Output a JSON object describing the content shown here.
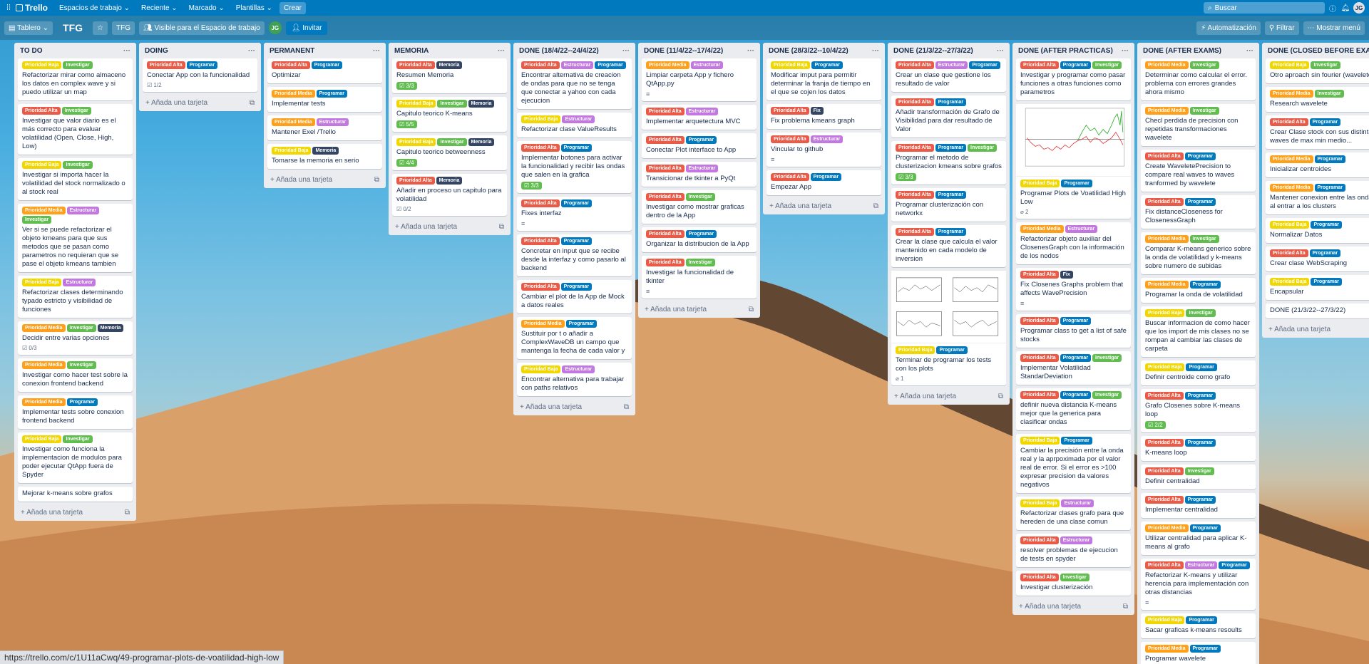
{
  "topbar": {
    "app": "Trello",
    "menus": [
      "Espacios de trabajo",
      "Reciente",
      "Marcado",
      "Plantillas"
    ],
    "create": "Crear",
    "search_placeholder": "Buscar",
    "avatar": "JG"
  },
  "boardbar": {
    "view": "Tablero",
    "title": "TFG",
    "workspace": "TFG",
    "visibility": "Visible para el Espacio de trabajo",
    "member": "JG",
    "invite": "Invitar",
    "automation": "Automatización",
    "filter": "Filtrar",
    "menu": "Mostrar menú"
  },
  "add_card": "Añada una tarjeta",
  "status_url": "https://trello.com/c/1U11aCwq/49-programar-plots-de-voatilidad-high-low",
  "label_colors": {
    "Prioridad Baja": "#f2d600",
    "Prioridad Media": "#ff9f1a",
    "Prioridad Alta": "#eb5a46",
    "Investigar": "#61bd4f",
    "Programar": "#0079bf",
    "Estructurar": "#c377e0",
    "Memoria": "#344563",
    "Fix": "#344563"
  },
  "lists": [
    {
      "title": "TO DO",
      "cards": [
        {
          "labels": [
            "Prioridad Baja",
            "Investigar"
          ],
          "title": "Refactorizar mirar como almaceno los datos en complex wave y si puedo utilizar un map"
        },
        {
          "labels": [
            "Prioridad Alta",
            "Investigar"
          ],
          "title": "Investigar que valor diario es el más correcto para evaluar volatilidad (Open, Close, High, Low)"
        },
        {
          "labels": [
            "Prioridad Baja",
            "Investigar"
          ],
          "title": "Investigar si importa hacer la volatilidad del stock normalizado o al stock real"
        },
        {
          "labels": [
            "Prioridad Media",
            "Estructurar",
            "Investigar"
          ],
          "title": "Ver si se puede refactorizar el objeto kmeans para que sus metodos que se pasan como parametros no requieran que se pase el objeto kmeans tambien"
        },
        {
          "labels": [
            "Prioridad Baja",
            "Estructurar"
          ],
          "title": "Refactorizar clases determinando typado estricto y visibilidad de funciones"
        },
        {
          "labels": [
            "Prioridad Media",
            "Investigar",
            "Memoria"
          ],
          "title": "Decidir entre varias opciones",
          "check": "0/3"
        },
        {
          "labels": [
            "Prioridad Media",
            "Investigar"
          ],
          "title": "Investigar como hacer test sobre la conexion frontend backend"
        },
        {
          "labels": [
            "Prioridad Media",
            "Programar"
          ],
          "title": "Implementar tests sobre conexion frontend backend"
        },
        {
          "labels": [
            "Prioridad Baja",
            "Investigar"
          ],
          "title": "Investigar como funciona la implementacion de modulos para poder ejecutar QtApp fuera de Spyder"
        },
        {
          "labels": [],
          "title": "Mejorar k-means sobre grafos"
        }
      ]
    },
    {
      "title": "DOING",
      "cards": [
        {
          "labels": [
            "Prioridad Alta",
            "Programar"
          ],
          "title": "Conectar App con la funcionalidad",
          "check": "1/2"
        }
      ]
    },
    {
      "title": "PERMANENT",
      "cards": [
        {
          "labels": [
            "Prioridad Alta",
            "Programar"
          ],
          "title": "Optimizar"
        },
        {
          "labels": [
            "Prioridad Media",
            "Programar"
          ],
          "title": "Implementar tests"
        },
        {
          "labels": [
            "Prioridad Media",
            "Estructurar"
          ],
          "title": "Mantener Exel /Trello"
        },
        {
          "labels": [
            "Prioridad Baja",
            "Memoria"
          ],
          "title": "Tomarse la memoria en serio"
        }
      ]
    },
    {
      "title": "MEMORIA",
      "cards": [
        {
          "labels": [
            "Prioridad Alta",
            "Memoria"
          ],
          "title": "Resumen Memoria",
          "checkdone": "3/3"
        },
        {
          "labels": [
            "Prioridad Baja",
            "Investigar",
            "Memoria"
          ],
          "title": "Capitulo teorico K-means",
          "checkdone": "5/5"
        },
        {
          "labels": [
            "Prioridad Baja",
            "Investigar",
            "Memoria"
          ],
          "title": "Capitulo teorico betweenness",
          "checkdone": "4/4"
        },
        {
          "labels": [
            "Prioridad Alta",
            "Memoria"
          ],
          "title": "Añadir en proceso un capitulo para volatilidad",
          "check": "0/2"
        }
      ]
    },
    {
      "title": "DONE (18/4/22--24/4/22)",
      "cards": [
        {
          "labels": [
            "Prioridad Alta",
            "Estructurar",
            "Programar"
          ],
          "title": "Encontrar alternativa de creacion de ondas para que no se tenga que conectar a yahoo con cada ejecucion"
        },
        {
          "labels": [
            "Prioridad Baja",
            "Estructurar"
          ],
          "title": "Refactorizar clase ValueResults"
        },
        {
          "labels": [
            "Prioridad Alta",
            "Programar"
          ],
          "title": "Implementar botones para activar la funcionalidad y recibir las ondas que salen en la grafica",
          "checkdone": "3/3"
        },
        {
          "labels": [
            "Prioridad Alta",
            "Programar"
          ],
          "title": "Fixes interfaz",
          "desc": true
        },
        {
          "labels": [
            "Prioridad Alta",
            "Programar"
          ],
          "title": "Concretar en input que se recibe desde la interfaz y como pasarlo al backend"
        },
        {
          "labels": [
            "Prioridad Alta",
            "Programar"
          ],
          "title": "Cambiar el plot de la App de Mock a datos reales"
        },
        {
          "labels": [
            "Prioridad Media",
            "Programar"
          ],
          "title": "Sustituir por t o añadir a ComplexWaveDB un campo que mantenga la fecha de cada valor y"
        },
        {
          "labels": [
            "Prioridad Baja",
            "Estructurar"
          ],
          "title": "Encontrar alternativa para trabajar con paths relativos"
        }
      ]
    },
    {
      "title": "DONE (11/4/22--17/4/22)",
      "cards": [
        {
          "labels": [
            "Prioridad Media",
            "Estructurar"
          ],
          "title": "Limpiar carpeta App y fichero QtApp.py",
          "desc": true
        },
        {
          "labels": [
            "Prioridad Alta",
            "Estructurar"
          ],
          "title": "Implementar arquetectura MVC"
        },
        {
          "labels": [
            "Prioridad Alta",
            "Programar"
          ],
          "title": "Conectar Plot interface to App"
        },
        {
          "labels": [
            "Prioridad Alta",
            "Estructurar"
          ],
          "title": "Transicionar de tkinter a PyQt"
        },
        {
          "labels": [
            "Prioridad Alta",
            "Investigar"
          ],
          "title": "Investigar como mostrar graficas dentro de la App"
        },
        {
          "labels": [
            "Prioridad Alta",
            "Programar"
          ],
          "title": "Organizar la distribucion de la App"
        },
        {
          "labels": [
            "Prioridad Alta",
            "Investigar"
          ],
          "title": "Investigar la funcionalidad de tkinter",
          "desc": true
        }
      ]
    },
    {
      "title": "DONE (28/3/22--10/4/22)",
      "cards": [
        {
          "labels": [
            "Prioridad Baja",
            "Programar"
          ],
          "title": "Modificar imput para permitir determinar la franja de tiempo en el que se cojen los datos"
        },
        {
          "labels": [
            "Prioridad Alta",
            "Fix"
          ],
          "title": "Fix problema kmeans graph"
        },
        {
          "labels": [
            "Prioridad Alta",
            "Estructurar"
          ],
          "title": "Vincular to github",
          "desc": true
        },
        {
          "labels": [
            "Prioridad Alta",
            "Programar"
          ],
          "title": "Empezar App"
        }
      ]
    },
    {
      "title": "DONE (21/3/22--27/3/22)",
      "cards": [
        {
          "labels": [
            "Prioridad Alta",
            "Estructurar",
            "Programar"
          ],
          "title": "Crear un clase que gestione los resultado de valor"
        },
        {
          "labels": [
            "Prioridad Alta",
            "Programar"
          ],
          "title": "Añadir transformación de Grafo de Visibilidad para dar resultado de Valor"
        },
        {
          "labels": [
            "Prioridad Alta",
            "Programar",
            "Investigar"
          ],
          "title": "Programar el metodo de clusterizacion kmeans sobre grafos",
          "checkdone": "3/3"
        },
        {
          "labels": [
            "Prioridad Alta",
            "Programar"
          ],
          "title": "Programar clusterización con networkx"
        },
        {
          "labels": [
            "Prioridad Alta",
            "Programar"
          ],
          "title": "Crear la clase que calcula el valor mantenido en cada modelo de inversion"
        },
        {
          "labels": [
            "Prioridad Baja",
            "Programar"
          ],
          "title": "Terminar de programar los tests con los plots",
          "thumb": "multi",
          "attach": "1"
        }
      ]
    },
    {
      "title": "DONE (AFTER PRACTICAS)",
      "cards": [
        {
          "labels": [
            "Prioridad Alta",
            "Programar",
            "Investigar"
          ],
          "title": "Investigar y programar como pasar funciones a otras funciones como parametros"
        },
        {
          "labels": [
            "Prioridad Baja",
            "Programar"
          ],
          "title": "Programar Plots de Voatilidad High Low",
          "thumb": "line",
          "attach": "2"
        },
        {
          "labels": [
            "Prioridad Media",
            "Estructurar"
          ],
          "title": "Refactorizar objeto auxiliar del ClosenesGraph con la información de los nodos"
        },
        {
          "labels": [
            "Prioridad Alta",
            "Fix"
          ],
          "title": "Fix Closenes Graphs problem that affects WavePrecision",
          "desc": true
        },
        {
          "labels": [
            "Prioridad Alta",
            "Programar"
          ],
          "title": "Programar class to get a list of safe stocks"
        },
        {
          "labels": [
            "Prioridad Alta",
            "Programar",
            "Investigar"
          ],
          "title": "Implementar Volatilidad StandarDeviation"
        },
        {
          "labels": [
            "Prioridad Alta",
            "Programar",
            "Investigar"
          ],
          "title": "definir nueva distancia K-means mejor que la generica para clasificar ondas"
        },
        {
          "labels": [
            "Prioridad Baja",
            "Programar"
          ],
          "title": "Cambiar la precisión entre la onda real y la aprpoximada por el valor real de error. Si el error es >100 expresar precision da valores negativos"
        },
        {
          "labels": [
            "Prioridad Baja",
            "Estructurar"
          ],
          "title": "Refactorizar clases grafo para que hereden de una clase comun"
        },
        {
          "labels": [
            "Prioridad Alta",
            "Estructurar"
          ],
          "title": "resolver problemas de ejecucion de tests en spyder"
        },
        {
          "labels": [
            "Prioridad Alta",
            "Investigar"
          ],
          "title": "Investigar clusterización"
        }
      ]
    },
    {
      "title": "DONE (AFTER EXAMS)",
      "cards": [
        {
          "labels": [
            "Prioridad Media",
            "Investigar"
          ],
          "title": "Determinar como calcular el error. problema con errores grandes ahora mismo"
        },
        {
          "labels": [
            "Prioridad Media",
            "Investigar"
          ],
          "title": "Checl perdida de precision con repetidas transformaciones wavelete"
        },
        {
          "labels": [
            "Prioridad Alta",
            "Programar"
          ],
          "title": "Create WaveletePrecision to compare real waves to waves tranformed by wavelete"
        },
        {
          "labels": [
            "Prioridad Alta",
            "Programar"
          ],
          "title": "Fix distanceCloseness for ClosenessGraph"
        },
        {
          "labels": [
            "Prioridad Media",
            "Investigar"
          ],
          "title": "Comparar K-means generico sobre la onda de volatilidad y k-means sobre numero de subidas"
        },
        {
          "labels": [
            "Prioridad Media",
            "Programar"
          ],
          "title": "Programar la onda de volatilidad"
        },
        {
          "labels": [
            "Prioridad Baja",
            "Investigar"
          ],
          "title": "Buscar informacion de como hacer que los import de mis clases no se rompan al cambiar las clases de carpeta"
        },
        {
          "labels": [
            "Prioridad Baja",
            "Programar"
          ],
          "title": "Definir centroide como grafo"
        },
        {
          "labels": [
            "Prioridad Alta",
            "Programar"
          ],
          "title": "Grafo Closenes sobre K-means loop",
          "checkdone": "2/2"
        },
        {
          "labels": [
            "Prioridad Alta",
            "Programar"
          ],
          "title": "K-means loop"
        },
        {
          "labels": [
            "Prioridad Alta",
            "Investigar"
          ],
          "title": "Definir centralidad"
        },
        {
          "labels": [
            "Prioridad Alta",
            "Programar"
          ],
          "title": "Implementar centralidad"
        },
        {
          "labels": [
            "Prioridad Media",
            "Programar"
          ],
          "title": "Utilizar centralidad para aplicar K-means al grafo"
        },
        {
          "labels": [
            "Prioridad Alta",
            "Estructurar",
            "Programar"
          ],
          "title": "Refactorizar K-means y utilizar herencia para implementación con otras distancias",
          "desc": true
        },
        {
          "labels": [
            "Prioridad Baja",
            "Programar"
          ],
          "title": "Sacar graficas k-means resoults"
        },
        {
          "labels": [
            "Prioridad Media",
            "Programar"
          ],
          "title": "Programar wavelete"
        }
      ]
    },
    {
      "title": "DONE (CLOSED BEFORE EXAMS)",
      "cards": [
        {
          "labels": [
            "Prioridad Baja",
            "Investigar"
          ],
          "title": "Otro aproach sin fourier (wavelete)"
        },
        {
          "labels": [
            "Prioridad Media",
            "Investigar"
          ],
          "title": "Research wavelete"
        },
        {
          "labels": [
            "Prioridad Alta",
            "Programar"
          ],
          "title": "Crear Clase stock con sus distintas waves de max min medio..."
        },
        {
          "labels": [
            "Prioridad Media",
            "Programar"
          ],
          "title": "Inicializar centroides"
        },
        {
          "labels": [
            "Prioridad Media",
            "Programar"
          ],
          "title": "Mantener conexion entre las ondas al entrar a los clusters"
        },
        {
          "labels": [
            "Prioridad Baja",
            "Programar"
          ],
          "title": "Normalizar Datos"
        },
        {
          "labels": [
            "Prioridad Alta",
            "Programar"
          ],
          "title": "Crear clase WebScraping"
        },
        {
          "labels": [
            "Prioridad Baja",
            "Programar"
          ],
          "title": "Encapsular"
        },
        {
          "labels": [],
          "title": "DONE (21/3/22--27/3/22)"
        }
      ]
    }
  ]
}
